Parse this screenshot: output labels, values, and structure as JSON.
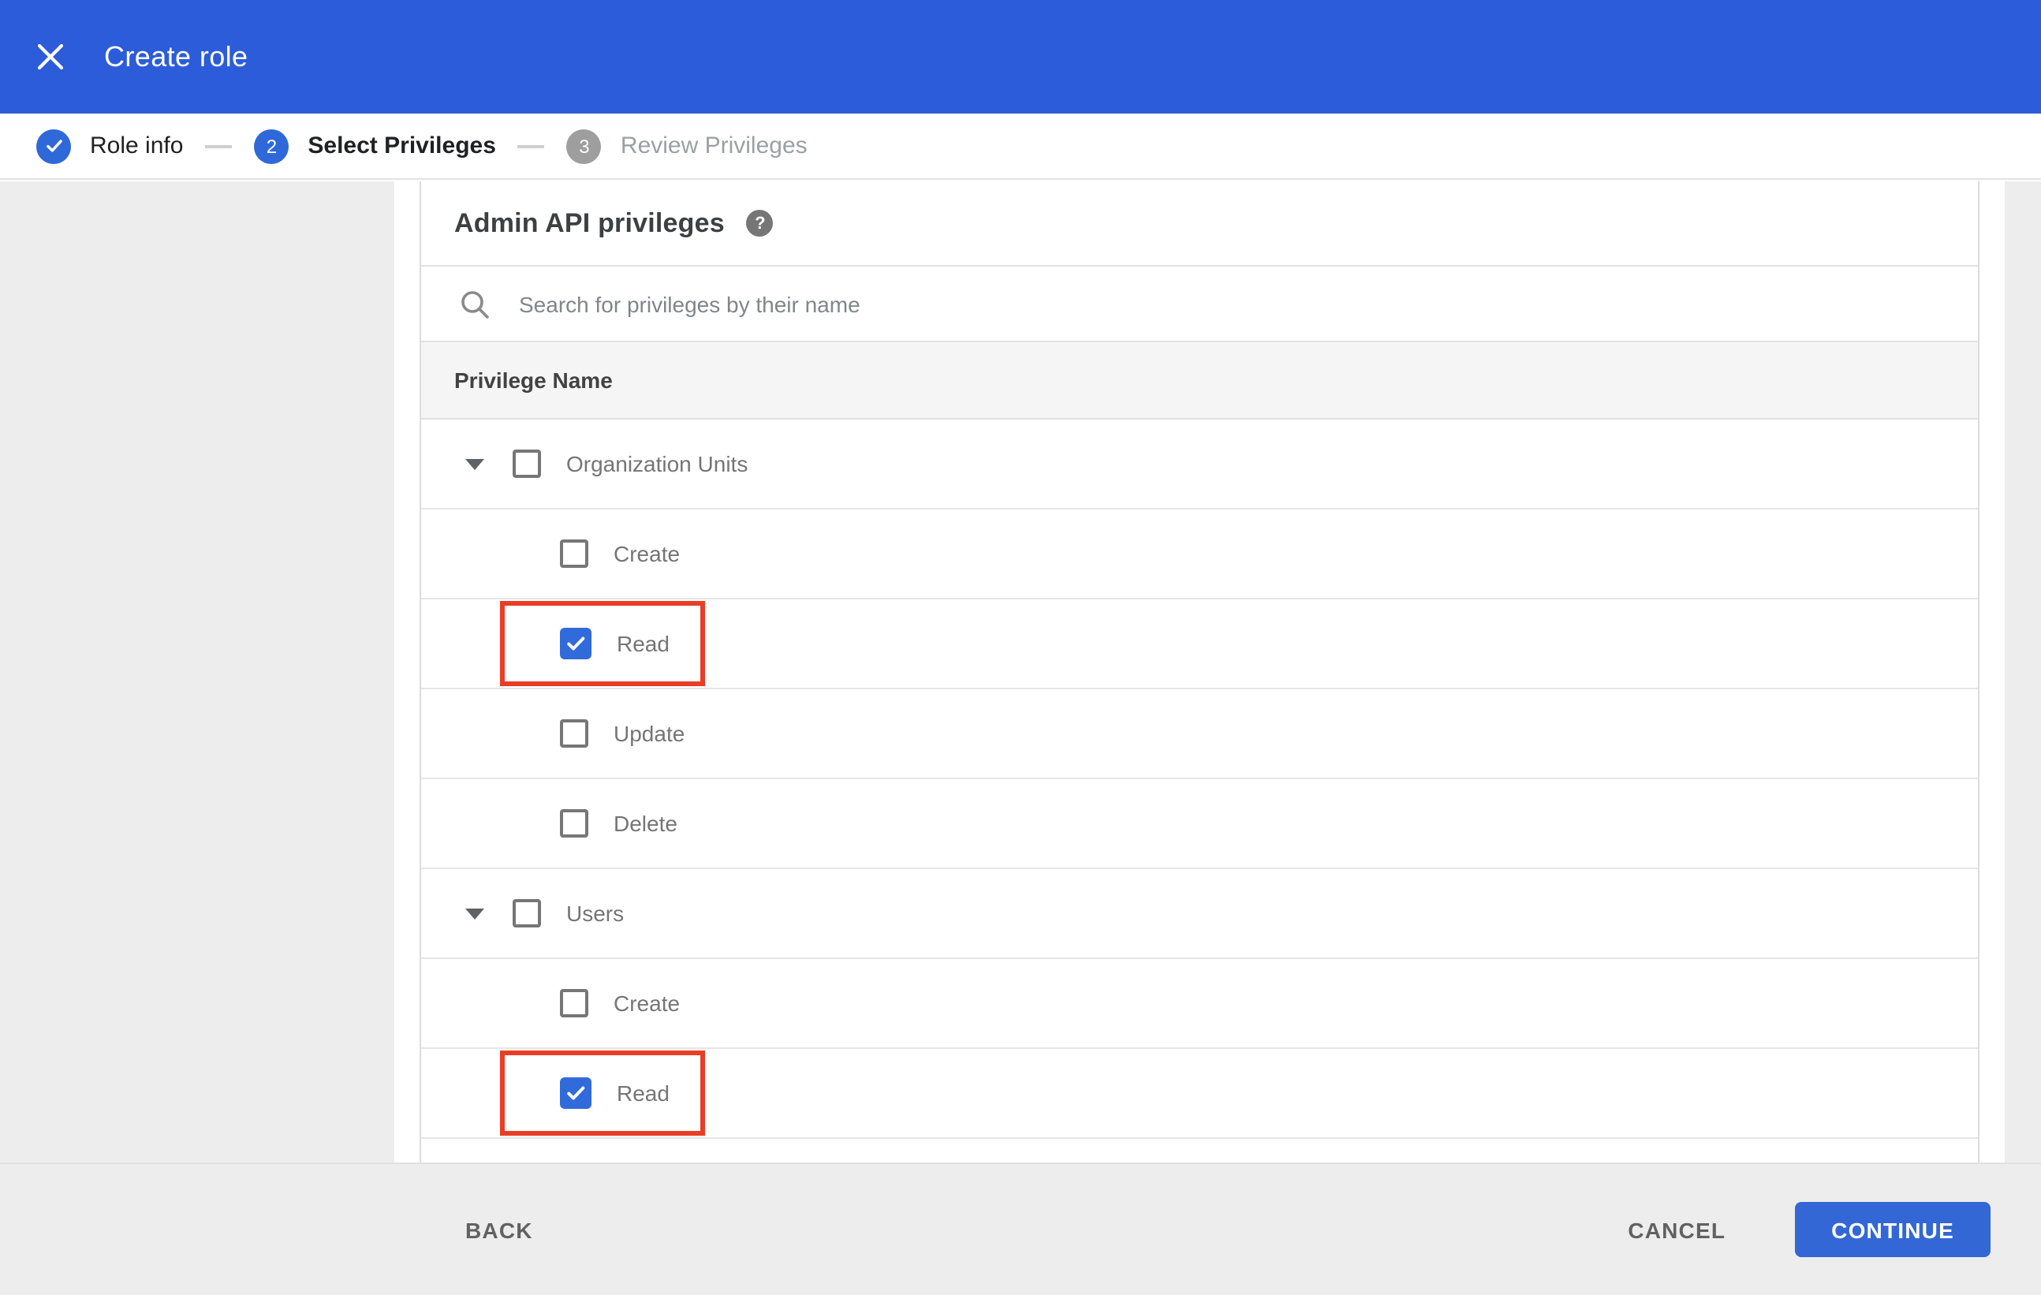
{
  "header": {
    "title": "Create role",
    "close_icon": "close-icon"
  },
  "stepper": {
    "steps": [
      {
        "label": "Role info",
        "state": "complete",
        "icon": "check-icon"
      },
      {
        "label": "Select Privileges",
        "state": "active",
        "number": "2"
      },
      {
        "label": "Review Privileges",
        "state": "upcoming",
        "number": "3"
      }
    ]
  },
  "panel": {
    "heading": "Admin API privileges",
    "help_icon": "help-icon",
    "help_glyph": "?",
    "search_icon": "search-icon",
    "search_placeholder": "Search for privileges by their name",
    "search_value": "",
    "column_header": "Privilege Name"
  },
  "privileges": [
    {
      "label": "Organization Units",
      "level": 0,
      "expander": true,
      "checked": false,
      "highlighted": false
    },
    {
      "label": "Create",
      "level": 1,
      "expander": false,
      "checked": false,
      "highlighted": false
    },
    {
      "label": "Read",
      "level": 1,
      "expander": false,
      "checked": true,
      "highlighted": true
    },
    {
      "label": "Update",
      "level": 1,
      "expander": false,
      "checked": false,
      "highlighted": false
    },
    {
      "label": "Delete",
      "level": 1,
      "expander": false,
      "checked": false,
      "highlighted": false
    },
    {
      "label": "Users",
      "level": 0,
      "expander": true,
      "checked": false,
      "highlighted": false
    },
    {
      "label": "Create",
      "level": 1,
      "expander": false,
      "checked": false,
      "highlighted": false
    },
    {
      "label": "Read",
      "level": 1,
      "expander": false,
      "checked": true,
      "highlighted": true
    }
  ],
  "footer": {
    "back_label": "BACK",
    "cancel_label": "CANCEL",
    "continue_label": "CONTINUE"
  },
  "colors": {
    "header_blue": "#2c5cd9",
    "step_blue": "#2f68d8",
    "step_inactive_gray": "#9e9e9e",
    "checkbox_blue": "#316bdb",
    "continue_blue": "#3367d6",
    "highlight_red": "#e93d25",
    "page_gray": "#ededed",
    "table_header_gray": "#f5f5f5"
  }
}
